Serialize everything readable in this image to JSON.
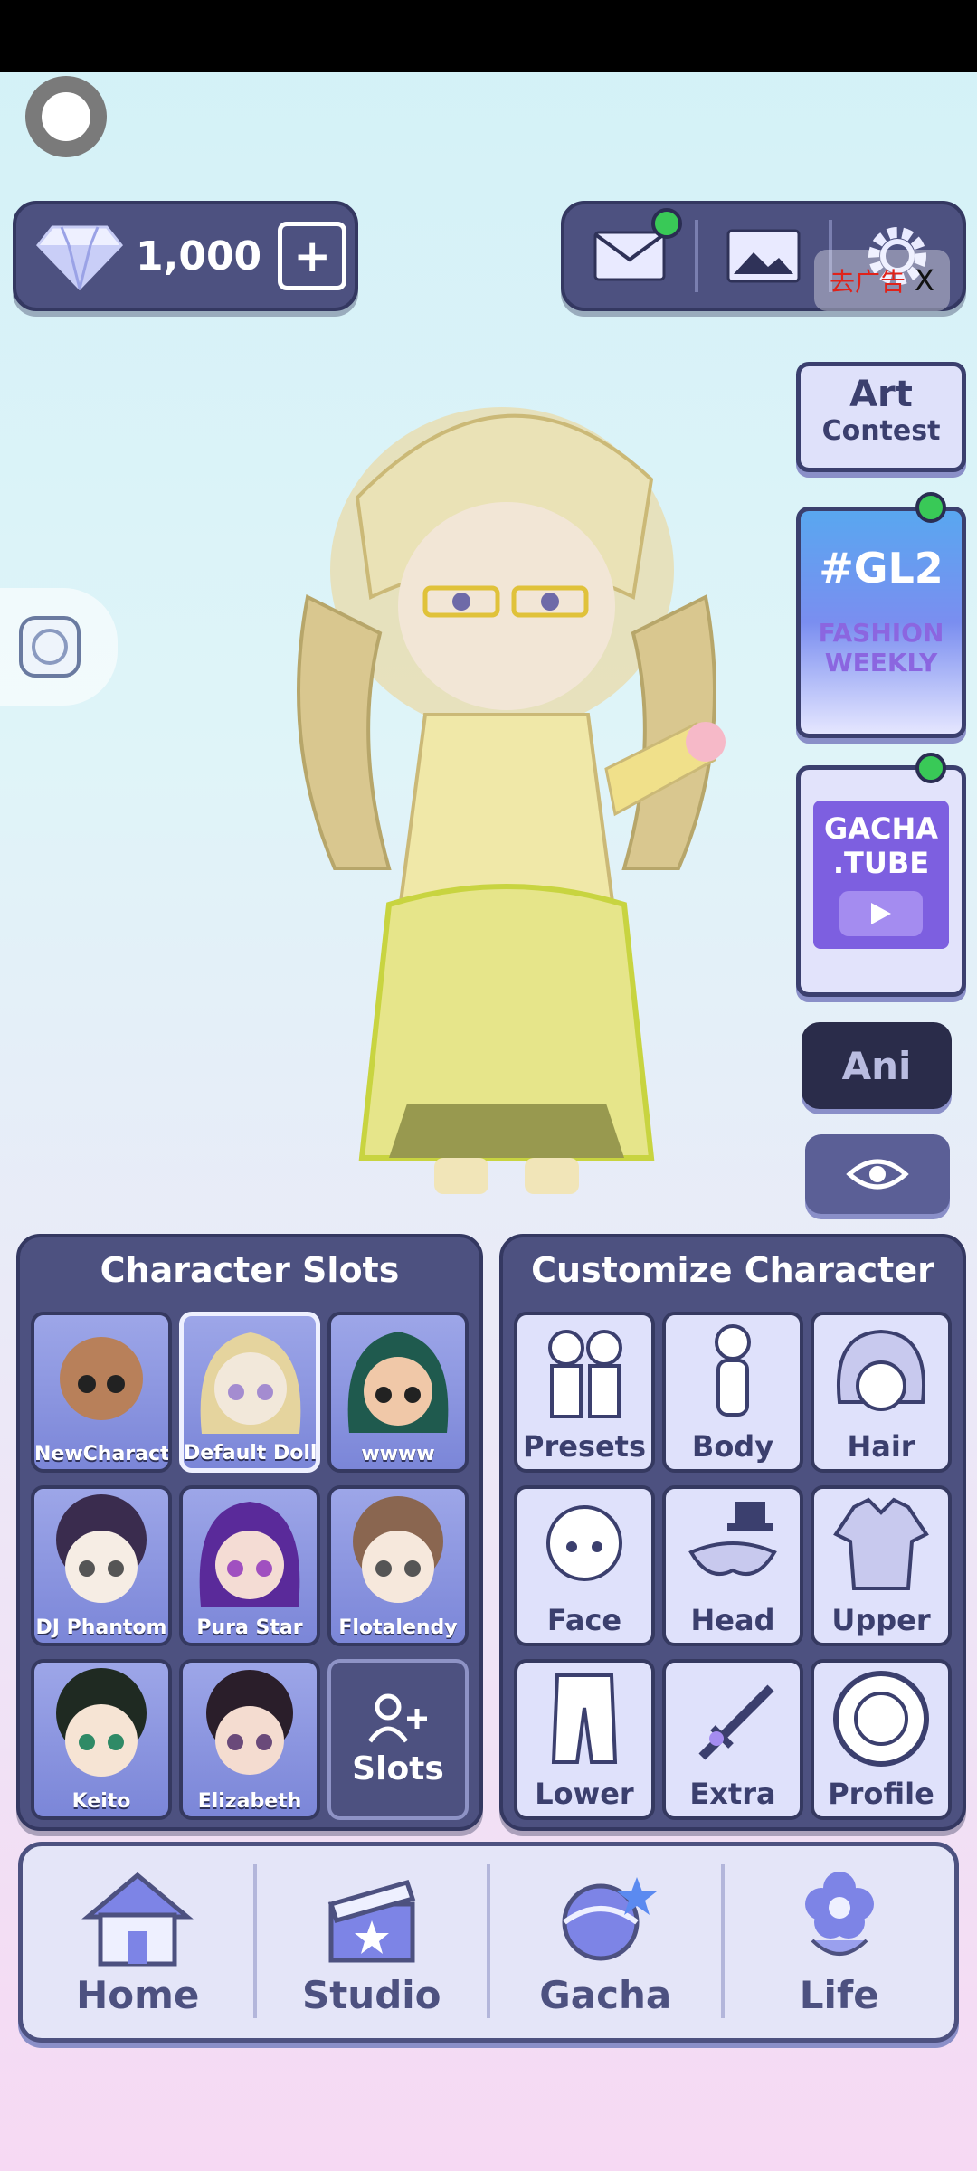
{
  "header": {
    "gems": "1,000",
    "ad_label": "去广告",
    "ad_close": "X"
  },
  "side_cards": {
    "art_contest": [
      "Art",
      "Contest"
    ],
    "gl2": {
      "tag": "#GL2",
      "line1": "FASHION",
      "line2": "WEEKLY"
    },
    "gacha_tube": {
      "line1": "GACHA",
      "line2": ".TUBE"
    },
    "ani": "Ani"
  },
  "character_slots": {
    "title": "Character Slots",
    "slots": [
      {
        "label": "NewCharacter"
      },
      {
        "label": "Default Doll"
      },
      {
        "label": "wwww"
      },
      {
        "label": "DJ Phantom"
      },
      {
        "label": "Pura Star"
      },
      {
        "label": "Flotalendy"
      },
      {
        "label": "Keito"
      },
      {
        "label": "Elizabeth"
      }
    ],
    "add_label": "Slots"
  },
  "customize": {
    "title": "Customize Character",
    "items": [
      "Presets",
      "Body",
      "Hair",
      "Face",
      "Head",
      "Upper",
      "Lower",
      "Extra",
      "Profile"
    ]
  },
  "nav": {
    "items": [
      "Home",
      "Studio",
      "Gacha",
      "Life"
    ]
  },
  "colors": {
    "panel": "#4d5180",
    "panel_border": "#343861",
    "slot_bg": "#8e97e0",
    "cust_bg": "#dfe1fb",
    "green_dot": "#39c957",
    "ad_text": "#e0221a"
  }
}
